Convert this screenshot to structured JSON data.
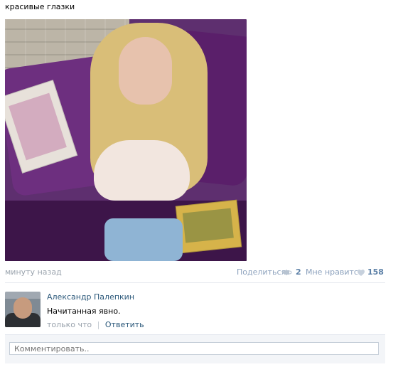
{
  "post": {
    "text": "красивые глазки",
    "time": "минуту назад",
    "share_label": "Поделиться",
    "share_count": "2",
    "like_label": "Мне нравится",
    "like_count": "158",
    "colors": {
      "link": "#2b587a",
      "muted": "#9aa3ad",
      "accent": "#8da2bd"
    }
  },
  "comment": {
    "author": "Александр Палепкин",
    "text": "Начитанная явно.",
    "time": "только что",
    "separator": "|",
    "reply": "Ответить"
  },
  "composer": {
    "placeholder": "Комментировать.."
  },
  "icons": {
    "share": "megaphone-icon",
    "like": "heart-icon"
  }
}
